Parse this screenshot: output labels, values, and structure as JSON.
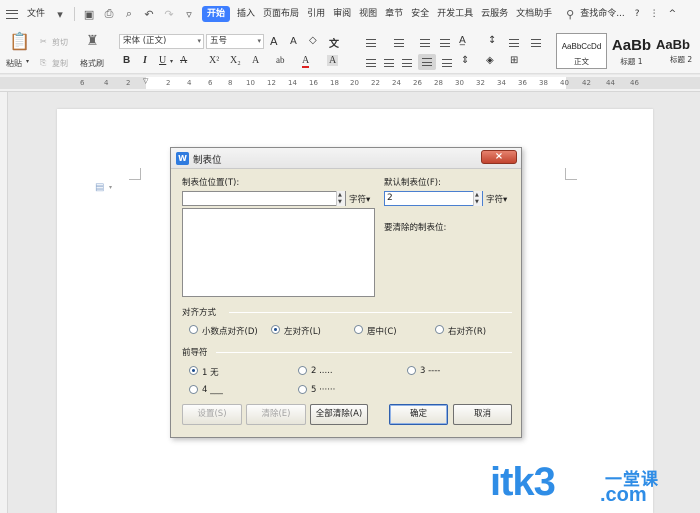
{
  "menubar": {
    "file_label": "文件",
    "tabs": [
      "开始",
      "插入",
      "页面布局",
      "引用",
      "审阅",
      "视图",
      "章节",
      "安全",
      "开发工具",
      "云服务",
      "文档助手"
    ],
    "active_tab": "开始",
    "search_label": "查找命令...",
    "help": "?",
    "more": "⋮",
    "collapse": "^"
  },
  "ribbon": {
    "paste": "粘贴",
    "cut": "剪切",
    "copy": "复制",
    "format_painter": "格式刷",
    "font_name": "宋体 (正文)",
    "font_size": "五号",
    "styles": [
      {
        "preview": "AaBbCcDd",
        "name": "正文"
      },
      {
        "preview": "AaBb",
        "name": "标题 1"
      },
      {
        "preview": "AaBb",
        "name": "标题 2"
      }
    ]
  },
  "ruler": {
    "numbers": [
      "6",
      "4",
      "2",
      "2",
      "4",
      "6",
      "8",
      "10",
      "12",
      "14",
      "16",
      "18",
      "20",
      "22",
      "24",
      "26",
      "28",
      "30",
      "32",
      "34",
      "36",
      "38",
      "40",
      "42",
      "44",
      "46"
    ]
  },
  "dialog": {
    "title": "制表位",
    "close": "×",
    "tab_position_label": "制表位位置(T):",
    "tab_position_value": "",
    "default_tab_label": "默认制表位(F):",
    "default_tab_value": "2",
    "unit": "字符▾",
    "to_clear_label": "要清除的制表位:",
    "alignment_label": "对齐方式",
    "alignment_options": [
      "小数点对齐(D)",
      "左对齐(L)",
      "居中(C)",
      "右对齐(R)"
    ],
    "alignment_selected": "左对齐(L)",
    "leader_label": "前导符",
    "leader_options": [
      "1 无",
      "2 .....",
      "3 ----",
      "4 ___",
      "5 ······"
    ],
    "leader_selected": "1 无",
    "buttons": {
      "set": "设置(S)",
      "clear": "清除(E)",
      "clear_all": "全部清除(A)",
      "ok": "确定",
      "cancel": "取消"
    }
  },
  "watermark": {
    "logo": "itk3",
    "sub": "一堂课",
    "suffix": ".com"
  },
  "colors": {
    "accent": "#3d7eff",
    "close_button": "#c1442f",
    "dialog_bg": "#ece9d8",
    "watermark": "#2f8de6"
  }
}
